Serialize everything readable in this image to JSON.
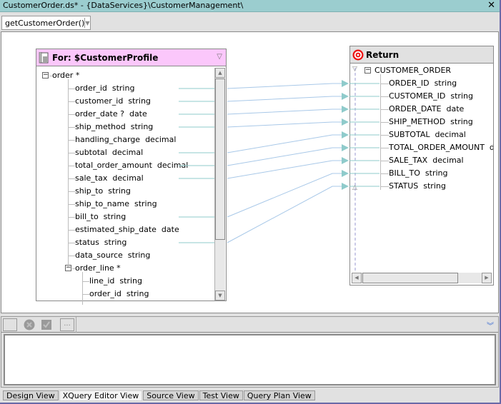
{
  "window": {
    "title": "CustomerOrder.ds* - {DataServices}\\CustomerManagement\\",
    "close_icon": "close-icon"
  },
  "toolbar": {
    "function_select": {
      "value": "getCustomerOrder()",
      "icon": "chevron-down-icon"
    }
  },
  "for_box": {
    "title": "For: $CustomerProfile",
    "icon": "document-table-icon",
    "pin_icon": "pin-icon",
    "header_color": "#fbc7fb",
    "items": [
      {
        "label": "order *",
        "level": 0,
        "expandable": true
      },
      {
        "label": "order_id  string",
        "level": 1
      },
      {
        "label": "customer_id  string",
        "level": 1
      },
      {
        "label": "order_date ?  date",
        "level": 1
      },
      {
        "label": "ship_method  string",
        "level": 1
      },
      {
        "label": "handling_charge  decimal",
        "level": 1
      },
      {
        "label": "subtotal  decimal",
        "level": 1
      },
      {
        "label": "total_order_amount  decimal",
        "level": 1
      },
      {
        "label": "sale_tax  decimal",
        "level": 1
      },
      {
        "label": "ship_to  string",
        "level": 1
      },
      {
        "label": "ship_to_name  string",
        "level": 1
      },
      {
        "label": "bill_to  string",
        "level": 1
      },
      {
        "label": "estimated_ship_date  date",
        "level": 1
      },
      {
        "label": "status  string",
        "level": 1
      },
      {
        "label": "data_source  string",
        "level": 1
      },
      {
        "label": "order_line *",
        "level": 1,
        "expandable": true
      },
      {
        "label": "line_id  string",
        "level": 2
      },
      {
        "label": "order_id  string",
        "level": 2
      }
    ]
  },
  "return_box": {
    "title": "Return",
    "icon": "target-icon",
    "root": "CUSTOMER_ORDER",
    "items": [
      {
        "label": "ORDER_ID  string"
      },
      {
        "label": "CUSTOMER_ID  string"
      },
      {
        "label": "ORDER_DATE  date"
      },
      {
        "label": "SHIP_METHOD  string"
      },
      {
        "label": "SUBTOTAL  decimal"
      },
      {
        "label": "TOTAL_ORDER_AMOUNT  decimal"
      },
      {
        "label": "SALE_TAX  decimal"
      },
      {
        "label": "BILL_TO  string"
      },
      {
        "label": "STATUS  string"
      }
    ]
  },
  "mappings": [
    {
      "from": 1,
      "to": 0
    },
    {
      "from": 2,
      "to": 1
    },
    {
      "from": 3,
      "to": 2
    },
    {
      "from": 4,
      "to": 3
    },
    {
      "from": 6,
      "to": 4
    },
    {
      "from": 7,
      "to": 5
    },
    {
      "from": 8,
      "to": 6
    },
    {
      "from": 11,
      "to": 7
    },
    {
      "from": 13,
      "to": 8
    }
  ],
  "link_color": "#8fcbcb",
  "bottom_panel": {
    "buttons": [
      {
        "name": "blank-button",
        "label": ""
      },
      {
        "name": "cancel-button",
        "icon": "cancel-icon"
      },
      {
        "name": "apply-button",
        "icon": "check-icon"
      },
      {
        "name": "more-button",
        "label": "..."
      }
    ],
    "collapse_icon": "double-chevron-down-icon"
  },
  "tabs": [
    {
      "label": "Design View",
      "active": false
    },
    {
      "label": "XQuery Editor View",
      "active": true
    },
    {
      "label": "Source View",
      "active": false
    },
    {
      "label": "Test View",
      "active": false
    },
    {
      "label": "Query Plan View",
      "active": false
    }
  ]
}
